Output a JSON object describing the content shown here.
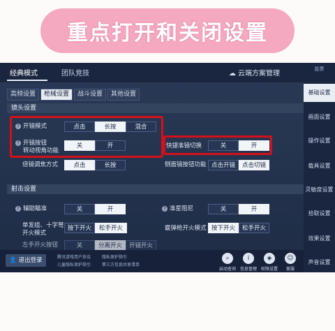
{
  "banner": {
    "text": "重点打开和关闭设置"
  },
  "top_tabs": [
    {
      "label": "经典模式",
      "active": true
    },
    {
      "label": "团队竞技",
      "active": false
    }
  ],
  "cloud": {
    "label": "云端方案管理"
  },
  "sub_tabs": [
    {
      "label": "高频设置",
      "active": false
    },
    {
      "label": "枪械设置",
      "active": true
    },
    {
      "label": "战斗设置",
      "active": false
    },
    {
      "label": "其他设置",
      "active": false
    }
  ],
  "scope": {
    "section_title": "镜头设置",
    "open_mode_label": "开镜模式",
    "open_mode_options": [
      "点击",
      "长按",
      "混合"
    ],
    "open_button_label_1": "开镜按钮",
    "open_button_label_2": "转动视角功能",
    "open_button_options": [
      "关",
      "开"
    ],
    "quick_switch_label": "快捷准镜切换",
    "quick_switch_options": [
      "关",
      "开"
    ],
    "zoom_mode_label": "倍镜调焦方式",
    "zoom_mode_options": [
      "点击",
      "长按"
    ],
    "side_scope_label": "侧面镜按钮功能",
    "side_scope_options": [
      "点击开镜",
      "点击切镜"
    ]
  },
  "shoot": {
    "section_title": "射击设置",
    "aim_assist_label": "辅助瞄准",
    "aim_assist_options": [
      "关",
      "开"
    ],
    "crosshair_damping_label": "准星阻尼",
    "crosshair_damping_options": [
      "关",
      "开"
    ],
    "single_fire_label_1": "单发组、十字弩",
    "single_fire_label_2": "开火模式",
    "single_fire_options": [
      "按下开火",
      "松手开火"
    ],
    "shotgun_label": "霰弹枪开火模式",
    "shotgun_options": [
      "按下开火",
      "松手开火"
    ],
    "partial_row": [
      "左手开火按钮",
      "关",
      "分离开火",
      "开镜开火"
    ]
  },
  "sidebar": {
    "top_label": "投票",
    "items": [
      "基础设置",
      "画面设置",
      "操作设置",
      "载具设置",
      "灵敏度设置",
      "拾取设置",
      "效果设置",
      "声音设置"
    ]
  },
  "bottom": {
    "logout": "退出登录",
    "links": [
      "腾讯游戏用户协议",
      "隐私保护指引",
      "儿童隐私保护指引",
      "第三方信息共享清单"
    ],
    "icons": [
      {
        "icon": "search-icon",
        "label": "启动查询"
      },
      {
        "icon": "info-icon",
        "label": "信息管理"
      },
      {
        "icon": "privacy-icon",
        "label": "权限设置"
      },
      {
        "icon": "service-icon",
        "label": "客服"
      }
    ]
  },
  "colors": {
    "banner": "#f4a9c0",
    "highlight": "#d4111a",
    "panel": "#1e2c45"
  }
}
